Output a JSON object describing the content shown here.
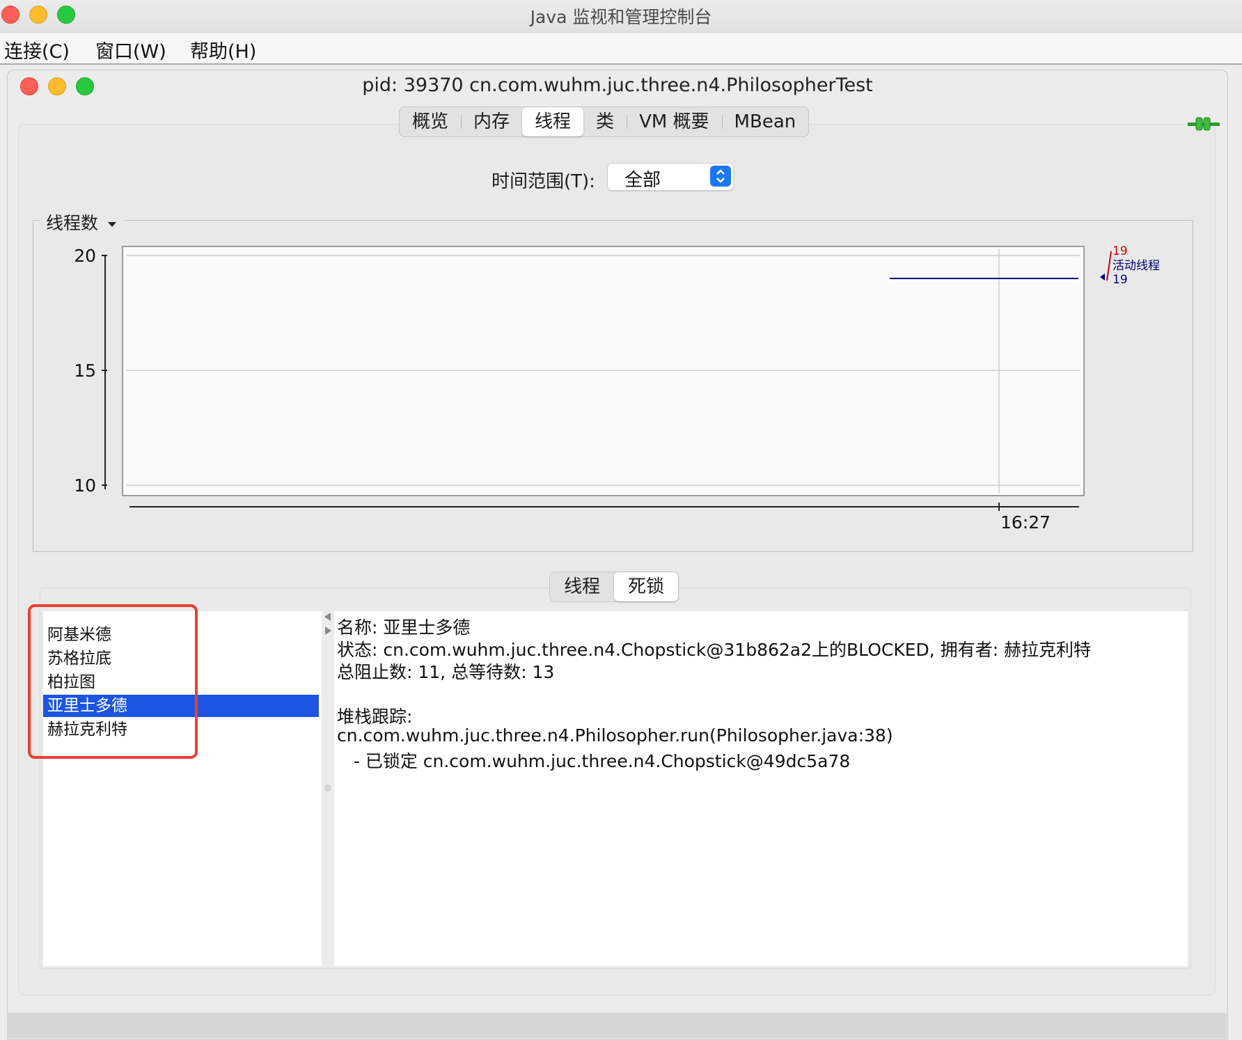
{
  "app": {
    "title": "Java 监视和管理控制台",
    "menu": [
      "连接(C)",
      "窗口(W)",
      "帮助(H)"
    ]
  },
  "window": {
    "title": "pid: 39370 cn.com.wuhm.juc.three.n4.PhilosopherTest",
    "tabs": [
      {
        "label": "概览",
        "active": false
      },
      {
        "label": "内存",
        "active": false
      },
      {
        "label": "线程",
        "active": true
      },
      {
        "label": "类",
        "active": false
      },
      {
        "label": "VM 概要",
        "active": false
      },
      {
        "label": "MBean",
        "active": false
      }
    ]
  },
  "time_range": {
    "label": "时间范围(T):",
    "value": "全部"
  },
  "chart": {
    "group_title": "线程数"
  },
  "chart_data": {
    "type": "line",
    "yticks": [
      "20",
      "15",
      "10"
    ],
    "ylim": [
      10,
      20
    ],
    "xticks": [
      "16:27"
    ],
    "series": [
      {
        "name": "活动线程",
        "value": 19,
        "color": "#000080"
      }
    ],
    "peak": {
      "value": 19,
      "color": "#cc0000"
    }
  },
  "subtabs": [
    {
      "label": "线程",
      "active": false
    },
    {
      "label": "死锁",
      "active": true
    }
  ],
  "threads": [
    {
      "name": "阿基米德",
      "selected": false
    },
    {
      "name": "苏格拉底",
      "selected": false
    },
    {
      "name": "柏拉图",
      "selected": false
    },
    {
      "name": "亚里士多德",
      "selected": true
    },
    {
      "name": "赫拉克利特",
      "selected": false
    }
  ],
  "details": {
    "name_line": "名称: 亚里士多德",
    "state_line": "状态: cn.com.wuhm.juc.three.n4.Chopstick@31b862a2上的BLOCKED, 拥有者: 赫拉克利特",
    "counts_line": "总阻止数: 11, 总等待数: 13",
    "stack_label": "堆栈跟踪:",
    "stack_frame": "cn.com.wuhm.juc.three.n4.Philosopher.run(Philosopher.java:38)",
    "lock_line": "   - 已锁定 cn.com.wuhm.juc.three.n4.Chopstick@49dc5a78"
  },
  "colors": {
    "selection": "#1b55e0",
    "highlight_box": "#e8412f",
    "peak": "#cc0000",
    "live": "#000080"
  }
}
